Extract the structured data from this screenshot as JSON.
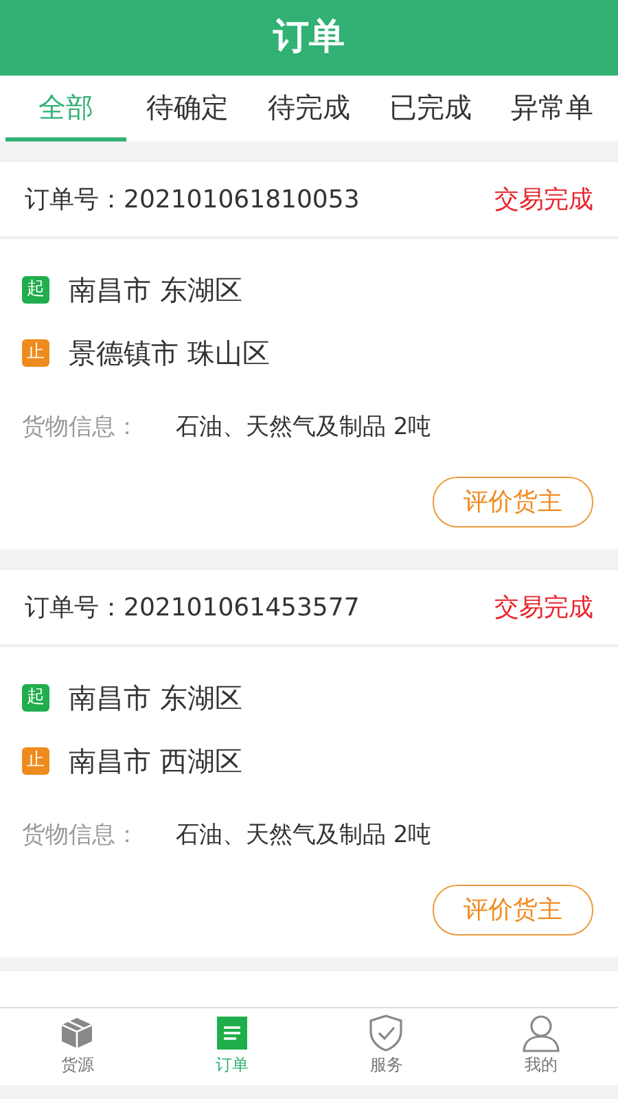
{
  "header": {
    "title": "订单"
  },
  "tabs": [
    {
      "label": "全部",
      "selected": true
    },
    {
      "label": "待确定",
      "selected": false
    },
    {
      "label": "待完成",
      "selected": false
    },
    {
      "label": "已完成",
      "selected": false
    },
    {
      "label": "异常单",
      "selected": false
    }
  ],
  "orders": [
    {
      "order_label": "订单号：",
      "order_no": "202101061810053",
      "status": "交易完成",
      "stops": [
        {
          "kind": "start",
          "badge": "起",
          "place": "南昌市 东湖区"
        },
        {
          "kind": "end",
          "badge": "止",
          "place": "景德镇市 珠山区"
        }
      ],
      "cargo_label": "货物信息：",
      "cargo": "石油、天然气及制品 2吨",
      "action": "评价货主"
    },
    {
      "order_label": "订单号：",
      "order_no": "202101061453577",
      "status": "交易完成",
      "stops": [
        {
          "kind": "start",
          "badge": "起",
          "place": "南昌市 东湖区"
        },
        {
          "kind": "end",
          "badge": "止",
          "place": "南昌市 西湖区"
        }
      ],
      "cargo_label": "货物信息：",
      "cargo": "石油、天然气及制品 2吨",
      "action": "评价货主"
    }
  ],
  "bottom_nav": [
    {
      "kind": "box",
      "label": "货源",
      "selected": false
    },
    {
      "kind": "list",
      "label": "订单",
      "selected": true
    },
    {
      "kind": "shield",
      "label": "服务",
      "selected": false
    },
    {
      "kind": "person",
      "label": "我的",
      "selected": false
    }
  ]
}
